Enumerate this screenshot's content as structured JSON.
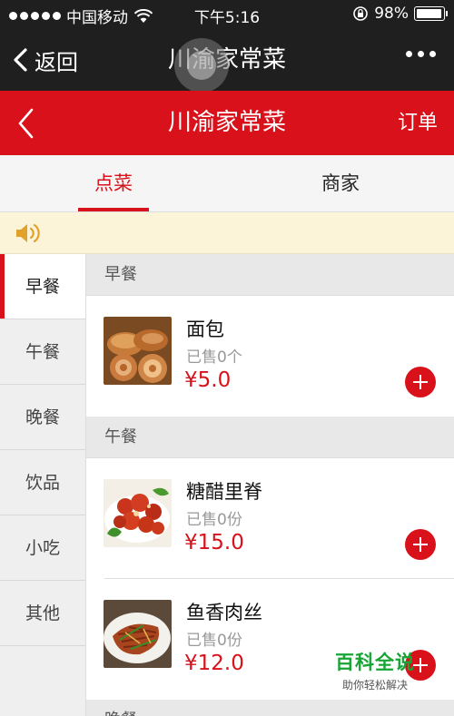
{
  "status_bar": {
    "carrier": "中国移动",
    "time": "下午5:16",
    "battery": "98%",
    "battery_level": 0.98
  },
  "wechat_nav": {
    "back_label": "返回",
    "title": "川渝家常菜"
  },
  "app_header": {
    "title": "川渝家常菜",
    "order_label": "订单"
  },
  "tabs": [
    {
      "label": "点菜",
      "active": true
    },
    {
      "label": "商家",
      "active": false
    }
  ],
  "sidebar": {
    "items": [
      {
        "label": "早餐",
        "active": true
      },
      {
        "label": "午餐",
        "active": false
      },
      {
        "label": "晚餐",
        "active": false
      },
      {
        "label": "饮品",
        "active": false
      },
      {
        "label": "小吃",
        "active": false
      },
      {
        "label": "其他",
        "active": false
      }
    ]
  },
  "menu": {
    "sections": [
      {
        "title": "早餐",
        "dishes": [
          {
            "name": "面包",
            "sold": "已售0个",
            "price": "¥5.0",
            "image": "bread-photo"
          }
        ]
      },
      {
        "title": "午餐",
        "dishes": [
          {
            "name": "糖醋里脊",
            "sold": "已售0份",
            "price": "¥15.0",
            "image": "sweet-sour-pork-photo"
          },
          {
            "name": "鱼香肉丝",
            "sold": "已售0份",
            "price": "¥12.0",
            "image": "shredded-pork-photo"
          }
        ]
      },
      {
        "title": "晚餐"
      }
    ]
  },
  "watermark": {
    "title": "百科全说",
    "subtitle": "助你轻松解决"
  },
  "colors": {
    "accent": "#d9111a",
    "dark_bar": "#1f1f1f",
    "notice_bg": "#fcf4d9",
    "watermark_green": "#16a535"
  }
}
